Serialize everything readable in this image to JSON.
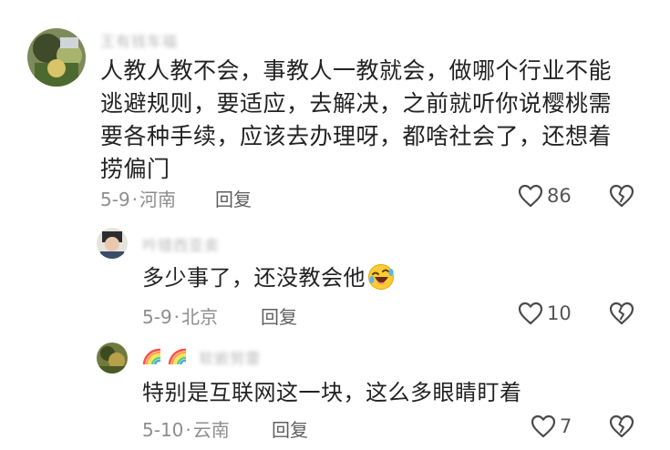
{
  "comments": [
    {
      "username": "王有钱车福",
      "lines": [
        "人教人教不会，事教人一教就会，做哪个行业不能",
        "逃避规则，要适应，去解决，之前就听你说樱桃需",
        "要各种手续，应该去办理呀，都啥社会了，还想着",
        "捞偏门"
      ],
      "date": "5-9",
      "location": "河南",
      "reply_label": "回复",
      "likes": "86"
    },
    {
      "username": "吟错西亚卖",
      "text": "多少事了，还没教会他",
      "emoji": "rolling-on-floor-laughing-emoji",
      "date": "5-9",
      "location": "北京",
      "reply_label": "回复",
      "likes": "10"
    },
    {
      "username": "软嵌努雷",
      "text": "特别是互联网这一块，这么多眼睛盯着",
      "date": "5-10",
      "location": "云南",
      "reply_label": "回复",
      "likes": "7"
    }
  ],
  "separator": "·",
  "icons": {
    "like": "heart-outline-icon",
    "dislike": "broken-heart-icon"
  },
  "colors": {
    "text": "#222222",
    "meta": "#8e8e8e",
    "username": "#b9b9b9"
  }
}
